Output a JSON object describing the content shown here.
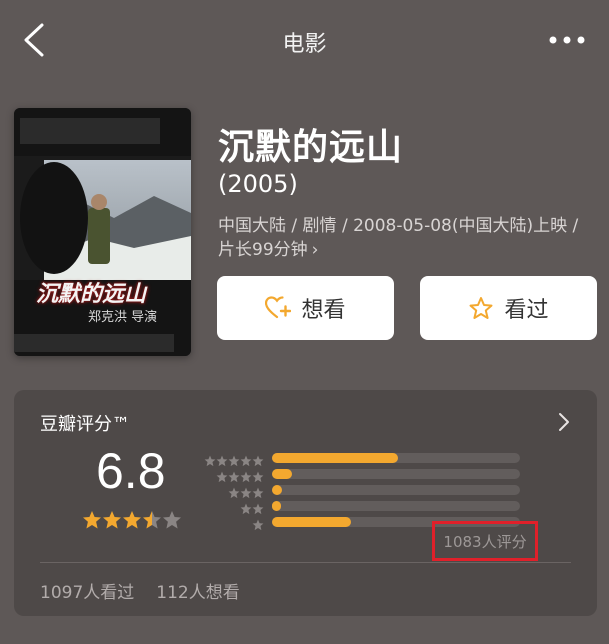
{
  "nav": {
    "title": "电影"
  },
  "movie": {
    "title": "沉默的远山",
    "year": "(2005)",
    "meta": "中国大陆 / 剧情 / 2008-05-08(中国大陆)上映 / 片长99分钟",
    "meta_chevron": "›",
    "want_label": "想看",
    "seen_label": "看过",
    "poster": {
      "title_overlay": "沉默的远山",
      "director_overlay": "郑克洪 导演"
    }
  },
  "rating": {
    "header": "豆瓣评分™",
    "score": "6.8",
    "score_stars": 3.5,
    "distribution": [
      {
        "stars": 5,
        "fraction": 0.51
      },
      {
        "stars": 4,
        "fraction": 0.08
      },
      {
        "stars": 3,
        "fraction": 0.04
      },
      {
        "stars": 2,
        "fraction": 0.03
      },
      {
        "stars": 1,
        "fraction": 0.32
      }
    ],
    "count": "1083人评分",
    "seen": "1097人看过",
    "want": "112人想看"
  },
  "colors": {
    "star": "#f3a82f",
    "star_empty": "#8a8584",
    "highlight_box": "#e0202a"
  },
  "icons": [
    "back-chevron-icon",
    "more-dots-icon",
    "heart-plus-icon",
    "star-outline-icon",
    "chevron-right-icon"
  ]
}
